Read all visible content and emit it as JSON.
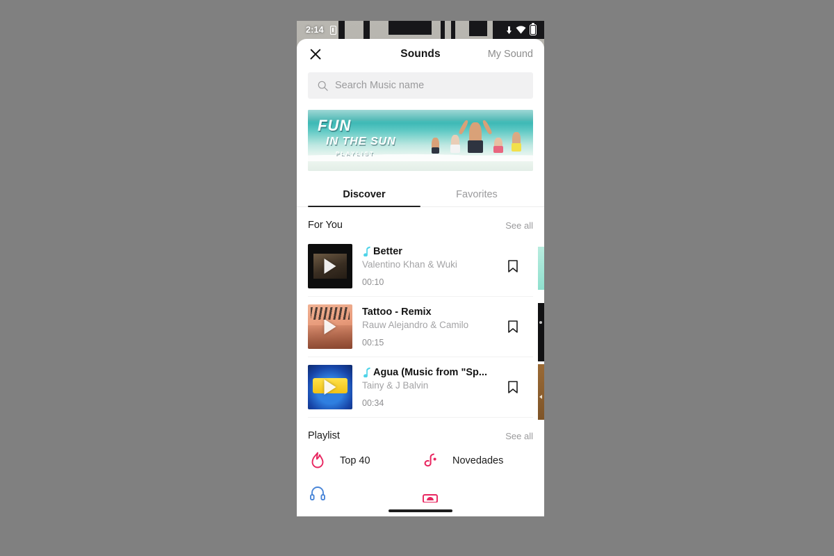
{
  "status_bar": {
    "time": "2:14",
    "icons": [
      "battery-small-icon",
      "data-transfer-icon",
      "wifi-icon",
      "battery-icon"
    ]
  },
  "header": {
    "close_icon": "close-icon",
    "title": "Sounds",
    "my_sound_label": "My Sound"
  },
  "search": {
    "placeholder": "Search Music name",
    "value": "",
    "icon": "search-icon"
  },
  "banner": {
    "line1": "FUN",
    "line2": "IN THE SUN",
    "line3": "PLAYLIST"
  },
  "tabs": [
    {
      "label": "Discover",
      "active": true
    },
    {
      "label": "Favorites",
      "active": false
    }
  ],
  "for_you": {
    "title": "For You",
    "see_all": "See all",
    "songs": [
      {
        "title": "Better",
        "artist": "Valentino Khan & Wuki",
        "duration": "00:10",
        "has_note_icon": true,
        "note_color": "#4fd3e8",
        "art": "art-better",
        "bookmark_icon": "bookmark-icon"
      },
      {
        "title": "Tattoo - Remix",
        "artist": "Rauw Alejandro & Camilo",
        "duration": "00:15",
        "has_note_icon": false,
        "note_color": "#4fd3e8",
        "art": "art-tattoo",
        "bookmark_icon": "bookmark-icon"
      },
      {
        "title": "Agua (Music from \"Sp...",
        "artist": "Tainy & J Balvin",
        "duration": "00:34",
        "has_note_icon": true,
        "note_color": "#4fd3e8",
        "art": "art-agua",
        "bookmark_icon": "bookmark-icon"
      }
    ]
  },
  "playlist": {
    "title": "Playlist",
    "see_all": "See all",
    "items": [
      {
        "label": "Top 40",
        "icon": "flame-icon",
        "color": "#e8255f"
      },
      {
        "label": "Novedades",
        "icon": "tiktok-note-icon",
        "color": "#e8255f"
      }
    ]
  },
  "colors": {
    "accent_pink": "#e8255f",
    "accent_cyan": "#4fd3e8",
    "text_primary": "#141414",
    "text_muted": "#9a9a9c",
    "search_bg": "#f1f1f2"
  }
}
